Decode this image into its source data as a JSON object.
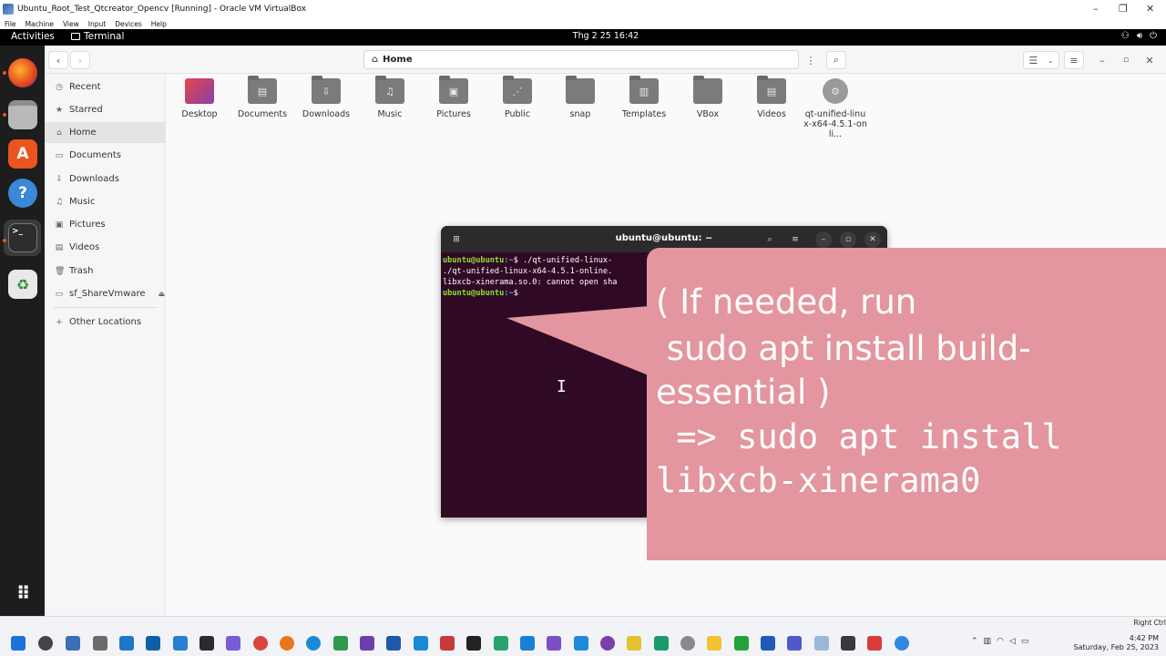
{
  "vbox": {
    "title": "Ubuntu_Root_Test_Qtcreator_Opencv [Running] - Oracle VM VirtualBox",
    "menu": [
      "File",
      "Machine",
      "View",
      "Input",
      "Devices",
      "Help"
    ]
  },
  "topbar": {
    "activities": "Activities",
    "app_name": "Terminal",
    "clock": "Thg 2 25  16:42"
  },
  "dock": {
    "apps": [
      "firefox-icon",
      "files-icon",
      "app-center-icon",
      "help-icon",
      "terminal-icon",
      "trash-icon",
      "show-apps-icon"
    ]
  },
  "files": {
    "location": "Home",
    "sidebar": [
      {
        "label": "Recent",
        "icon": "clock-icon"
      },
      {
        "label": "Starred",
        "icon": "star-icon"
      },
      {
        "label": "Home",
        "icon": "home-icon",
        "active": true
      },
      {
        "label": "Documents",
        "icon": "document-icon"
      },
      {
        "label": "Downloads",
        "icon": "download-icon"
      },
      {
        "label": "Music",
        "icon": "music-icon"
      },
      {
        "label": "Pictures",
        "icon": "picture-icon"
      },
      {
        "label": "Videos",
        "icon": "video-icon"
      },
      {
        "label": "Trash",
        "icon": "trash-icon"
      },
      {
        "label": "sf_ShareVmware",
        "icon": "share-icon"
      },
      {
        "label": "Other Locations",
        "icon": "plus-icon"
      }
    ],
    "items": [
      {
        "label": "Desktop"
      },
      {
        "label": "Documents"
      },
      {
        "label": "Downloads"
      },
      {
        "label": "Music"
      },
      {
        "label": "Pictures"
      },
      {
        "label": "Public"
      },
      {
        "label": "snap"
      },
      {
        "label": "Templates"
      },
      {
        "label": "VBox"
      },
      {
        "label": "Videos"
      },
      {
        "label": "qt-unified-linux-x64-4.5.1-onli..."
      }
    ]
  },
  "terminal": {
    "title": "ubuntu@ubuntu: ~",
    "prompt_user": "ubuntu@ubuntu",
    "prompt_path": ":~",
    "lines": [
      "$ ./qt-unified-linux-",
      "./qt-unified-linux-x64-4.5.1-online.",
      "libxcb-xinerama.so.0: cannot open sha",
      "$ "
    ]
  },
  "callout": {
    "line1": "( If needed, run",
    "line2": " sudo apt install build-",
    "line3": "essential )",
    "line4": " => sudo apt install",
    "line5": "libxcb-xinerama0"
  },
  "taskbar": {
    "right_ctrl": "Right Ctrl",
    "time": "4:42 PM",
    "date": "Saturday, Feb 25, 2023"
  }
}
